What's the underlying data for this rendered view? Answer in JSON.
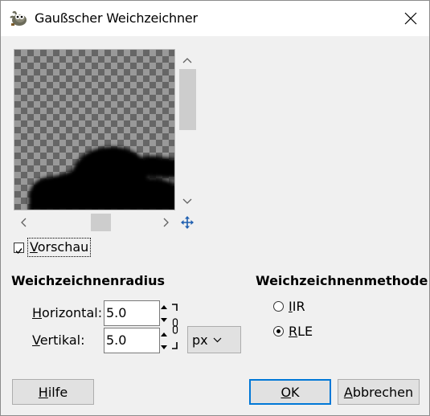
{
  "window": {
    "title": "Gaußscher Weichzeichner",
    "app_icon": "gimp-wilber-icon",
    "close_icon": "close-icon"
  },
  "preview": {
    "checkbox_label_mnemonic": "V",
    "checkbox_label_rest": "orschau",
    "checked": true,
    "navigate_icon": "four-way-arrow-icon"
  },
  "radius": {
    "section_title": "Weichzeichnenradius",
    "horizontal_mnemonic": "H",
    "horizontal_rest": "orizontal:",
    "horizontal_value": "5.0",
    "vertical_mnemonic": "V",
    "vertical_rest": "ertikal:",
    "vertical_value": "5.0",
    "unit": "px",
    "chain_icon": "chain-link-icon"
  },
  "method": {
    "section_title": "Weichzeichnenmethode",
    "options": [
      {
        "mnemonic": "I",
        "rest": "IR",
        "checked": false
      },
      {
        "mnemonic": "R",
        "rest": "LE",
        "checked": true
      }
    ]
  },
  "buttons": {
    "help_mnemonic": "H",
    "help_rest": "ilfe",
    "ok_mnemonic": "O",
    "ok_rest": "K",
    "cancel_mnemonic": "A",
    "cancel_rest": "bbrechen"
  },
  "colors": {
    "accent": "#0078d7",
    "button_bg": "#e1e1e1",
    "dialog_bg": "#f0f0f0"
  }
}
